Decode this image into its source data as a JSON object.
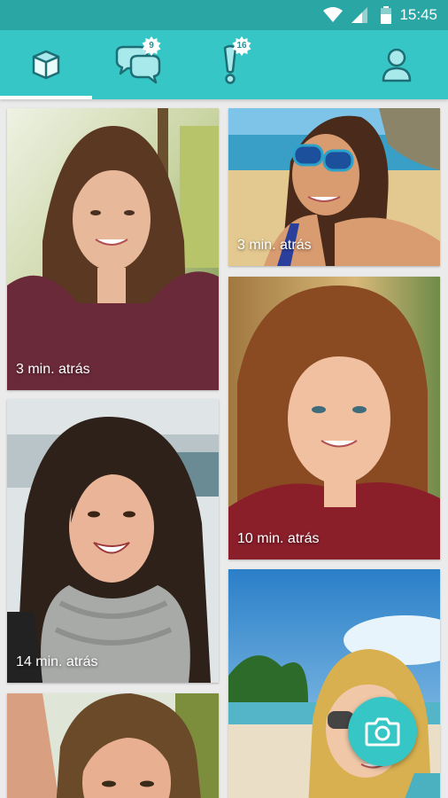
{
  "status_bar": {
    "time": "15:45"
  },
  "tabs": [
    {
      "name": "feed",
      "icon": "cube-icon",
      "active": true
    },
    {
      "name": "messages",
      "icon": "chat-bubbles-icon",
      "badge": "9"
    },
    {
      "name": "notifications",
      "icon": "exclamation-icon",
      "badge": "16"
    },
    {
      "name": "profile",
      "icon": "person-icon"
    }
  ],
  "cards": [
    {
      "caption": "3 min. atrás"
    },
    {
      "caption": "3 min. atrás"
    },
    {
      "caption": "10 min. atrás"
    },
    {
      "caption": "14 min. atrás"
    },
    {
      "caption": ""
    },
    {
      "caption": ""
    }
  ],
  "colors": {
    "accent": "#36c6c6",
    "status_bar": "#2aa6a5",
    "background": "#ebebeb"
  },
  "fab": {
    "icon": "camera-icon"
  }
}
